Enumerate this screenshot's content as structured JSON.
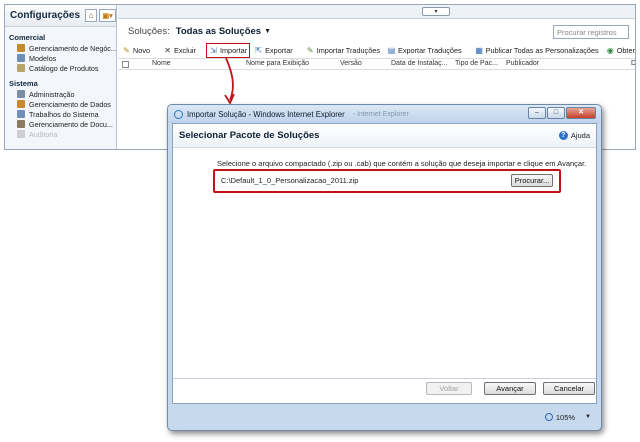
{
  "crm": {
    "nav_title": "Configurações",
    "groups": [
      {
        "label": "Comercial",
        "items": [
          {
            "label": "Gerenciamento de Negóc...",
            "color": "#c68a2c"
          },
          {
            "label": "Modelos",
            "color": "#6d8fb5"
          },
          {
            "label": "Catálogo de Produtos",
            "color": "#b9a36a"
          }
        ]
      },
      {
        "label": "Sistema",
        "items": [
          {
            "label": "Administração",
            "color": "#7a8da3"
          },
          {
            "label": "Gerenciamento de Dados",
            "color": "#c9882e"
          },
          {
            "label": "Trabalhos do Sistema",
            "color": "#6f8fb6"
          },
          {
            "label": "Gerenciamento de Docu...",
            "color": "#8a7b5e"
          },
          {
            "label": "Auditoria",
            "color": "#cfcfcf"
          }
        ]
      }
    ],
    "solutions_label": "Soluções:",
    "solutions_view": "Todas as Soluções",
    "search_placeholder": "Procurar registros",
    "toolbar": {
      "new": "Novo",
      "delete": "Excluir",
      "import": "Importar",
      "export": "Exportar",
      "import_translations": "Importar Traduções",
      "export_translations": "Exportar Traduções",
      "publish_all": "Publicar Todas as Personalizações",
      "get_solutions": "Obter soluçõ"
    },
    "columns": {
      "name": "Nome",
      "display_name": "Nome para Exibição",
      "version": "Versão",
      "install_date": "Data de Instalaç...",
      "package_type": "Tipo de Pac...",
      "publisher": "Publicador",
      "description": "De"
    }
  },
  "dialog": {
    "window_title": "Importar Solução - Windows Internet Explorer",
    "ghost_url": "- Internet Explorer",
    "header": "Selecionar Pacote de Soluções",
    "help": "Ajuda",
    "instructions": "Selecione o arquivo compactado (.zip ou .cab) que contém a solução que deseja importar e clique em Avançar.",
    "file_value": "C:\\Default_1_0_Personalizacao_2011.zip",
    "browse": "Procurar...",
    "back": "Voltar",
    "next": "Avançar",
    "cancel": "Cancelar",
    "zoom": "105%"
  },
  "colors": {
    "highlight": "#c2131b",
    "dialog_frame": "#c7d9ec"
  }
}
